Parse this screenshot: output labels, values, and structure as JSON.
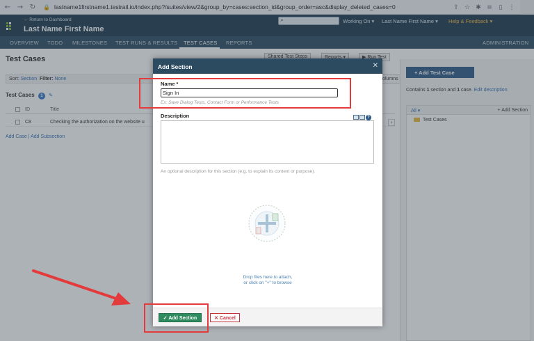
{
  "browser": {
    "url": "lastname1firstname1.testrail.io/index.php?/suites/view/2&group_by=cases:section_id&group_order=asc&display_deleted_cases=0",
    "icons": [
      "back-icon",
      "forward-icon",
      "reload-icon",
      "lock-icon",
      "share-icon",
      "star-icon",
      "extensions-icon",
      "reading-list-icon",
      "sidebar-icon"
    ]
  },
  "header": {
    "back_link": "← Return to Dashboard",
    "project_name": "Last Name First Name",
    "working_on": "Working On ▾",
    "user_name": "Last Name First Name ▾",
    "help": "Help & Feedback ▾"
  },
  "tabs": [
    "OVERVIEW",
    "TODO",
    "MILESTONES",
    "TEST RUNS & RESULTS",
    "TEST CASES",
    "REPORTS"
  ],
  "active_tab": "TEST CASES",
  "admin": "ADMINISTRATION",
  "page": {
    "title": "Test Cases",
    "shared_steps": "Shared Test Steps",
    "reports": "Reports ▾",
    "run_test": "▶ Run Test",
    "filter": {
      "sort_label": "Sort:",
      "sort_value": "Section",
      "filter_label": "Filter:",
      "filter_value": "None"
    },
    "columns": "Columns",
    "tc_header": "Test Cases",
    "tc_count": "1",
    "grid": {
      "id_header": "ID",
      "title_header": "Title",
      "row": {
        "id": "C8",
        "title": "Checking the authorization on the website u"
      }
    },
    "add_links": "Add Case | Add Subsection"
  },
  "sidebar": {
    "add_case": "+ Add Test Case",
    "contains_prefix": "Contains ",
    "contains_sections": "1",
    "contains_mid": " section and ",
    "contains_cases": "1",
    "contains_suffix": " case.",
    "edit_description": "Edit description",
    "tree_all": "All ▾",
    "tree_add": "+ Add Section",
    "tree_item": "Test Cases"
  },
  "modal": {
    "title": "Add Section",
    "name_label": "Name *",
    "name_value": "Sign In",
    "name_hint": "Ex: Save Dialog Tests, Contact Form or Performance Tests",
    "desc_label": "Description",
    "desc_hint": "An optional description for this section (e.g. to explain its content or purpose).",
    "drop_line1": "Drop files here to attach,",
    "drop_line2": "or click on \"+\" to browse",
    "add_button": "✓ Add Section",
    "cancel_button": "✕ Cancel"
  },
  "colors": {
    "header_bg": "#1d3a4e",
    "tabbar_bg": "#2a4a5f",
    "modal_header_bg": "#2c4a60",
    "add_button_bg": "#2f8a5f",
    "cancel_red": "#c7333d",
    "annotation_red": "#e33b3b"
  }
}
